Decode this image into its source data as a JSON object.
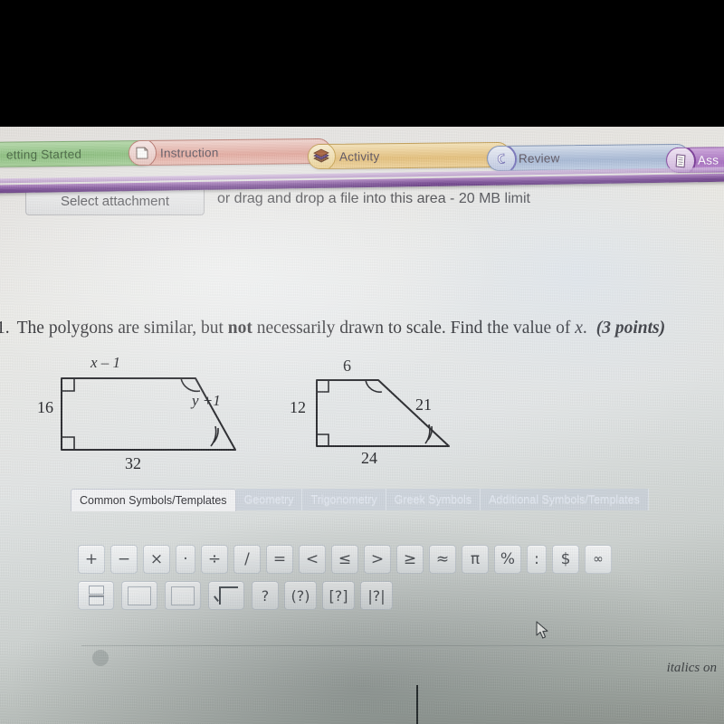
{
  "app": {
    "kind": "photo-of-screen",
    "colors": {
      "accent_purple": "#7b4f96",
      "tab_getting_started": "#9ccb8f",
      "tab_instruction": "#e8b8ae",
      "tab_activity": "#ecca86",
      "tab_review": "#adbcd8",
      "tab_assessment": "#b98cc9",
      "page_bg": "#e6e3df"
    }
  },
  "nav": {
    "name": "course-section-tabs",
    "tabs": [
      {
        "label": "etting Started",
        "full_label": "Getting Started",
        "icon": "flag-icon",
        "color": "#9ccb8f",
        "truncated": true
      },
      {
        "label": "Instruction",
        "icon": "page-icon",
        "color": "#e8b8ae",
        "truncated": false
      },
      {
        "label": "Activity",
        "icon": "books-icon",
        "color": "#ecca86",
        "truncated": false
      },
      {
        "label": "Review",
        "icon": "swirl-icon",
        "color": "#adbcd8",
        "truncated": false
      },
      {
        "label": "Ass",
        "full_label": "Assessment",
        "icon": "document-icon",
        "color": "#b98cc9",
        "truncated": true
      }
    ]
  },
  "attachment": {
    "button_label": "Select attachment",
    "hint_text": "or drag and drop a file into this area - 20 MB limit"
  },
  "question": {
    "number": "1.",
    "text_before_bold": "The polygons are similar, but ",
    "bold_word": "not",
    "text_after_bold": " necessarily drawn to scale. Find the value of ",
    "variable": "x",
    "period": ".",
    "points": "(3 points)"
  },
  "figures": [
    {
      "name": "trapezoid-left",
      "labels": {
        "top": "x – 1",
        "left": "16",
        "slant": "y +1",
        "bottom": "32"
      },
      "right_angles": 2,
      "congruence_marks": {
        "top_vertex": 1,
        "right_vertex": 2
      }
    },
    {
      "name": "trapezoid-right",
      "labels": {
        "top": "6",
        "left": "12",
        "slant": "21",
        "bottom": "24"
      },
      "right_angles": 2,
      "congruence_marks": {
        "top_vertex": 1,
        "right_vertex": 2
      }
    }
  ],
  "palette": {
    "name": "equation-symbol-palette",
    "tabs": [
      {
        "label": "Common Symbols/Templates",
        "active": true
      },
      {
        "label": "Geometry",
        "active": false
      },
      {
        "label": "Trigonometry",
        "active": false
      },
      {
        "label": "Greek Symbols",
        "active": false
      },
      {
        "label": "Additional Symbols/Templates",
        "active": false
      }
    ],
    "row1": [
      {
        "glyph": "+",
        "name": "plus"
      },
      {
        "glyph": "−",
        "name": "minus"
      },
      {
        "glyph": "×",
        "name": "times"
      },
      {
        "glyph": "·",
        "name": "dot-multiply"
      },
      {
        "glyph": "÷",
        "name": "divide"
      },
      {
        "glyph": "/",
        "name": "slash"
      },
      {
        "glyph": "=",
        "name": "equals"
      },
      {
        "glyph": "<",
        "name": "less-than"
      },
      {
        "glyph": "≤",
        "name": "less-than-or-equal"
      },
      {
        "glyph": ">",
        "name": "greater-than"
      },
      {
        "glyph": "≥",
        "name": "greater-than-or-equal"
      },
      {
        "glyph": "≈",
        "name": "approximately-equal"
      },
      {
        "glyph": "π",
        "name": "pi"
      },
      {
        "glyph": "%",
        "name": "percent"
      },
      {
        "glyph": ":",
        "name": "colon-ratio"
      },
      {
        "glyph": "$",
        "name": "dollar"
      },
      {
        "glyph": "∞",
        "name": "infinity"
      }
    ],
    "row2": [
      {
        "glyph": "",
        "name": "fraction-template"
      },
      {
        "glyph": "",
        "name": "empty-box-template"
      },
      {
        "glyph": "",
        "name": "empty-box-template-2"
      },
      {
        "glyph": "",
        "name": "square-root-template"
      },
      {
        "glyph": "?",
        "name": "question-placeholder"
      },
      {
        "glyph": "(?)",
        "name": "parenthesis-placeholder"
      },
      {
        "glyph": "[?]",
        "name": "bracket-placeholder"
      },
      {
        "glyph": "|?|",
        "name": "absolute-value-placeholder"
      }
    ]
  },
  "footer": {
    "italics_label": "italics on"
  }
}
